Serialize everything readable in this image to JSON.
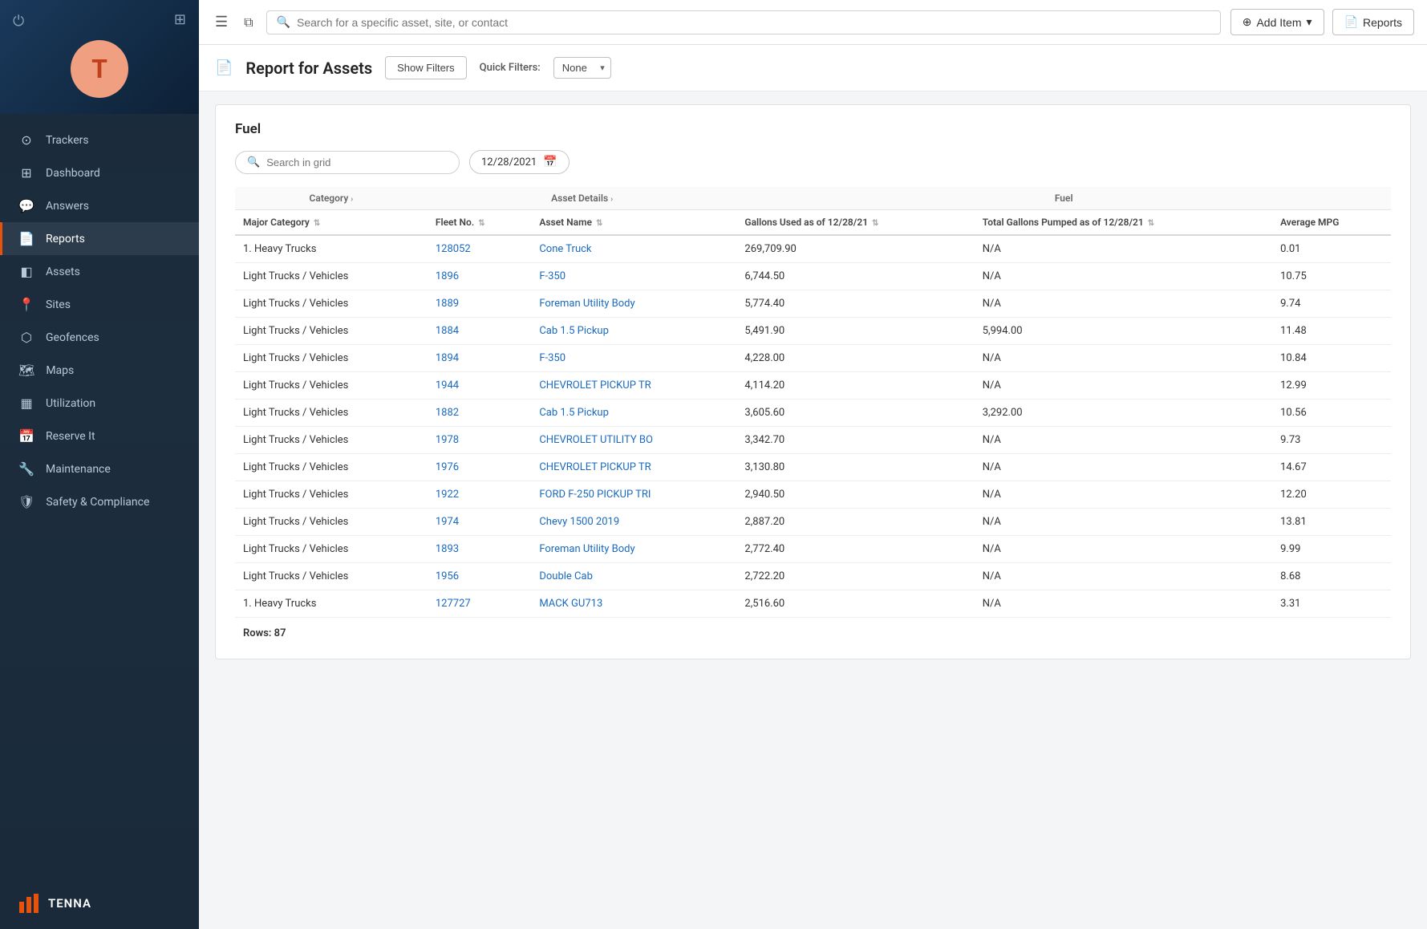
{
  "sidebar": {
    "avatar_initial": "T",
    "nav_items": [
      {
        "id": "trackers",
        "label": "Trackers",
        "icon": "⊙"
      },
      {
        "id": "dashboard",
        "label": "Dashboard",
        "icon": "⊞"
      },
      {
        "id": "answers",
        "label": "Answers",
        "icon": "💬"
      },
      {
        "id": "reports",
        "label": "Reports",
        "icon": "📄",
        "active": true
      },
      {
        "id": "assets",
        "label": "Assets",
        "icon": "◧"
      },
      {
        "id": "sites",
        "label": "Sites",
        "icon": "📍"
      },
      {
        "id": "geofences",
        "label": "Geofences",
        "icon": "⬡"
      },
      {
        "id": "maps",
        "label": "Maps",
        "icon": "🗺"
      },
      {
        "id": "utilization",
        "label": "Utilization",
        "icon": "▦"
      },
      {
        "id": "reserve-it",
        "label": "Reserve It",
        "icon": "📅"
      },
      {
        "id": "maintenance",
        "label": "Maintenance",
        "icon": "🔧"
      },
      {
        "id": "safety",
        "label": "Safety & Compliance",
        "icon": "🛡"
      }
    ],
    "footer": {
      "logo_text": "TENNA"
    }
  },
  "topbar": {
    "search_placeholder": "Search for a specific asset, site, or contact",
    "add_item_label": "Add Item",
    "reports_label": "Reports"
  },
  "page_header": {
    "title": "Report for Assets",
    "show_filters_label": "Show Filters",
    "quick_filters_label": "Quick Filters:",
    "quick_filters_value": "None"
  },
  "report": {
    "section_title": "Fuel",
    "grid_search_placeholder": "Search in grid",
    "date_value": "12/28/2021",
    "columns": {
      "category_group": "Category",
      "asset_details_group": "Asset Details",
      "fuel_group": "Fuel",
      "major_category": "Major Category",
      "fleet_no": "Fleet No.",
      "asset_name": "Asset Name",
      "gallons_used": "Gallons Used as of 12/28/21",
      "total_gallons": "Total Gallons Pumped as of 12/28/21",
      "avg_mpg": "Average MPG"
    },
    "rows": [
      {
        "major_category": "1. Heavy Trucks",
        "fleet_no": "128052",
        "asset_name": "Cone Truck",
        "gallons_used": "269,709.90",
        "total_gallons": "N/A",
        "avg_mpg": "0.01"
      },
      {
        "major_category": "Light Trucks / Vehicles",
        "fleet_no": "1896",
        "asset_name": "F-350",
        "gallons_used": "6,744.50",
        "total_gallons": "N/A",
        "avg_mpg": "10.75"
      },
      {
        "major_category": "Light Trucks / Vehicles",
        "fleet_no": "1889",
        "asset_name": "Foreman Utility Body",
        "gallons_used": "5,774.40",
        "total_gallons": "N/A",
        "avg_mpg": "9.74"
      },
      {
        "major_category": "Light Trucks / Vehicles",
        "fleet_no": "1884",
        "asset_name": "Cab 1.5 Pickup",
        "gallons_used": "5,491.90",
        "total_gallons": "5,994.00",
        "avg_mpg": "11.48"
      },
      {
        "major_category": "Light Trucks / Vehicles",
        "fleet_no": "1894",
        "asset_name": "F-350",
        "gallons_used": "4,228.00",
        "total_gallons": "N/A",
        "avg_mpg": "10.84"
      },
      {
        "major_category": "Light Trucks / Vehicles",
        "fleet_no": "1944",
        "asset_name": "CHEVROLET PICKUP TR",
        "gallons_used": "4,114.20",
        "total_gallons": "N/A",
        "avg_mpg": "12.99"
      },
      {
        "major_category": "Light Trucks / Vehicles",
        "fleet_no": "1882",
        "asset_name": "Cab 1.5 Pickup",
        "gallons_used": "3,605.60",
        "total_gallons": "3,292.00",
        "avg_mpg": "10.56"
      },
      {
        "major_category": "Light Trucks / Vehicles",
        "fleet_no": "1978",
        "asset_name": "CHEVROLET UTILITY BO",
        "gallons_used": "3,342.70",
        "total_gallons": "N/A",
        "avg_mpg": "9.73"
      },
      {
        "major_category": "Light Trucks / Vehicles",
        "fleet_no": "1976",
        "asset_name": "CHEVROLET PICKUP TR",
        "gallons_used": "3,130.80",
        "total_gallons": "N/A",
        "avg_mpg": "14.67"
      },
      {
        "major_category": "Light Trucks / Vehicles",
        "fleet_no": "1922",
        "asset_name": "FORD F-250 PICKUP TRI",
        "gallons_used": "2,940.50",
        "total_gallons": "N/A",
        "avg_mpg": "12.20"
      },
      {
        "major_category": "Light Trucks / Vehicles",
        "fleet_no": "1974",
        "asset_name": "Chevy 1500 2019",
        "gallons_used": "2,887.20",
        "total_gallons": "N/A",
        "avg_mpg": "13.81"
      },
      {
        "major_category": "Light Trucks / Vehicles",
        "fleet_no": "1893",
        "asset_name": "Foreman Utility Body",
        "gallons_used": "2,772.40",
        "total_gallons": "N/A",
        "avg_mpg": "9.99"
      },
      {
        "major_category": "Light Trucks / Vehicles",
        "fleet_no": "1956",
        "asset_name": "Double Cab",
        "gallons_used": "2,722.20",
        "total_gallons": "N/A",
        "avg_mpg": "8.68"
      },
      {
        "major_category": "1. Heavy Trucks",
        "fleet_no": "127727",
        "asset_name": "MACK GU713",
        "gallons_used": "2,516.60",
        "total_gallons": "N/A",
        "avg_mpg": "3.31"
      }
    ],
    "rows_count": "Rows: 87"
  }
}
